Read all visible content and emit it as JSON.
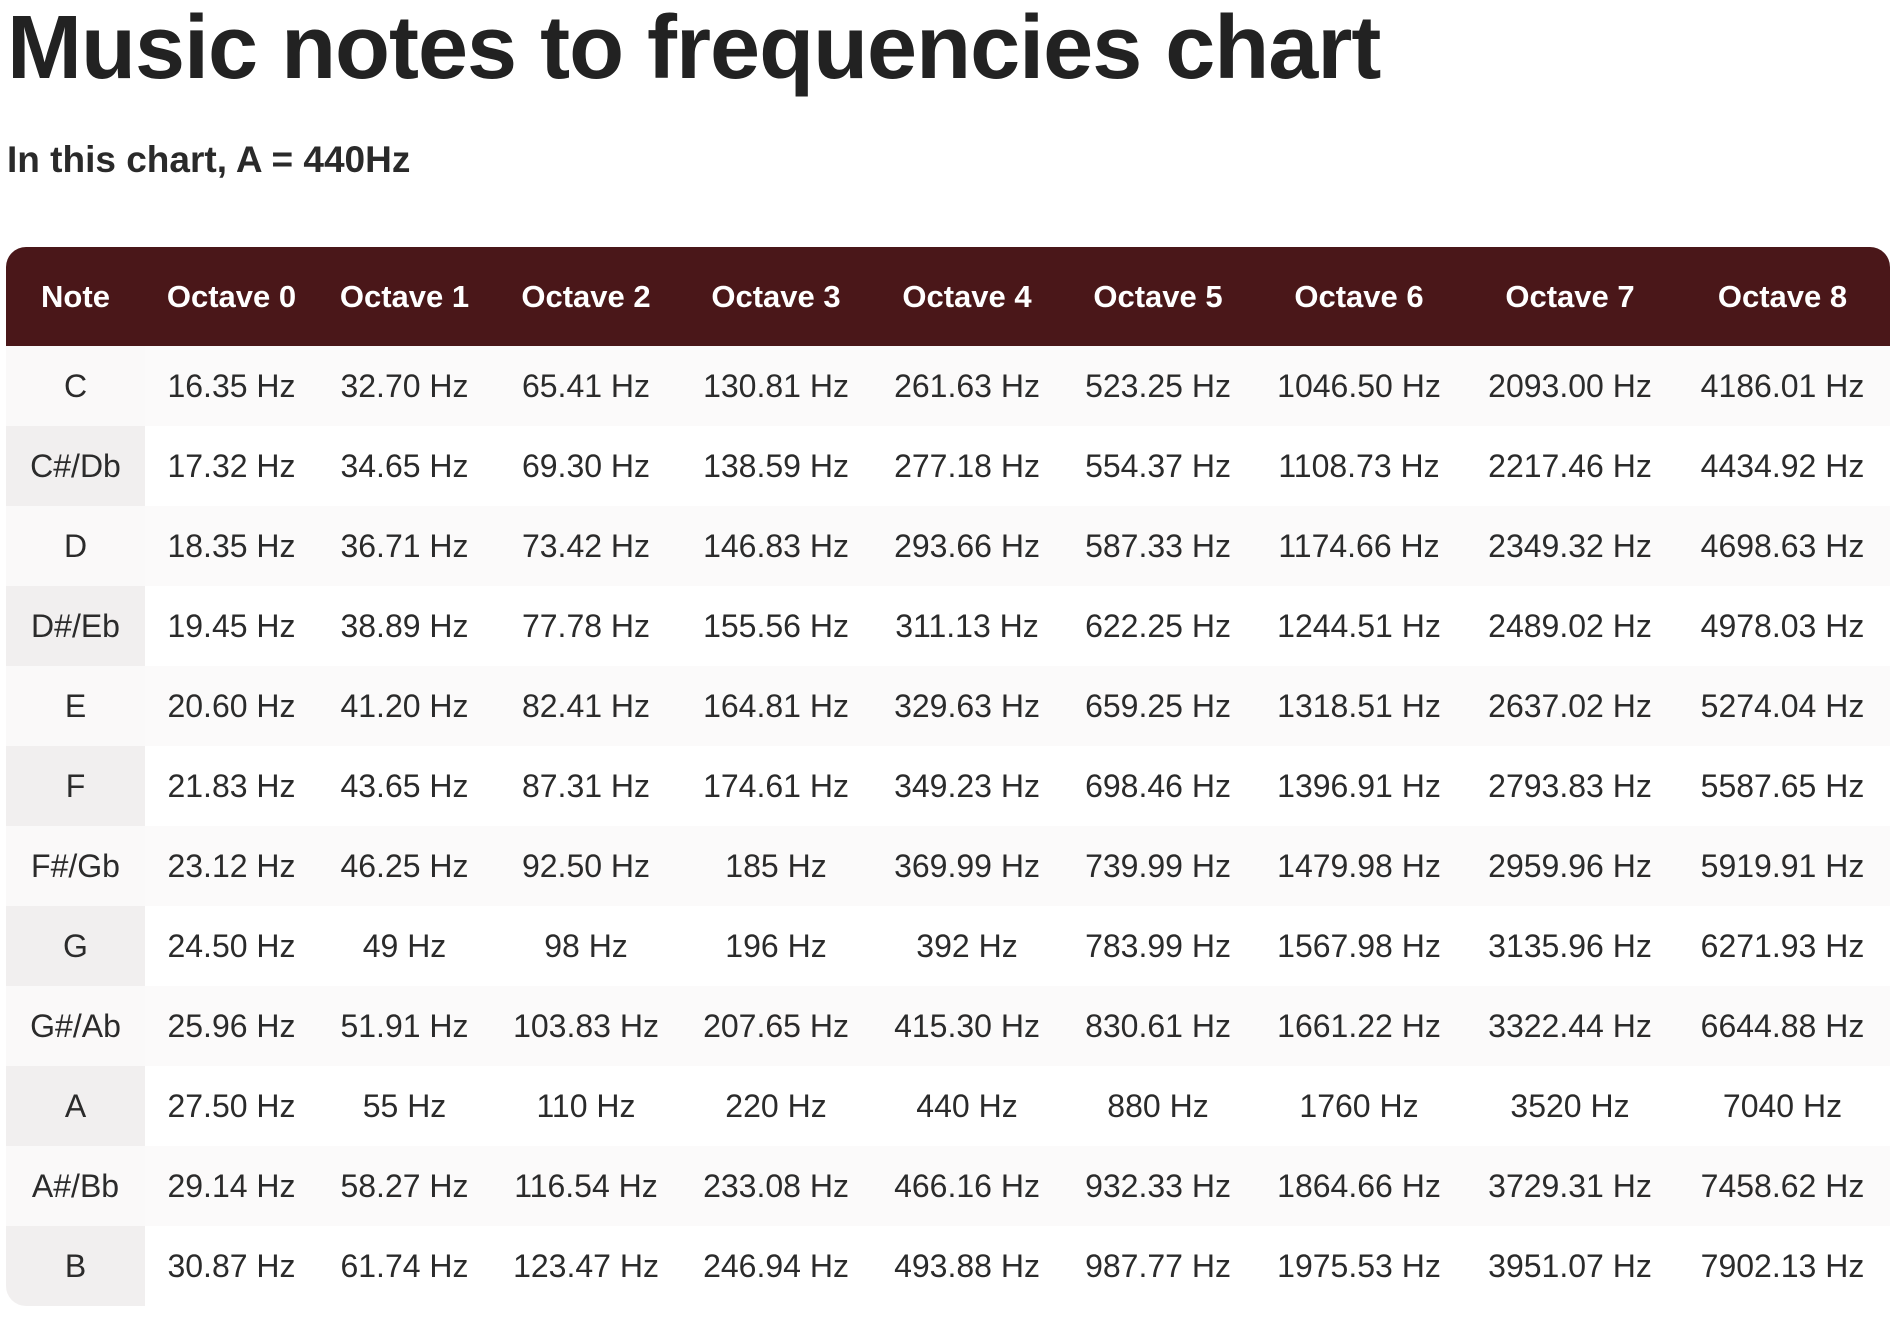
{
  "page": {
    "title": "Music notes to frequencies chart",
    "subtitle": "In this chart, A = 440Hz"
  },
  "colors": {
    "header_background": "#4a1719",
    "header_text": "#ffffff",
    "note_column_background": "#f3f1f1",
    "body_text": "#2b2b2b"
  },
  "table": {
    "headers": [
      "Note",
      "Octave 0",
      "Octave 1",
      "Octave 2",
      "Octave 3",
      "Octave 4",
      "Octave 5",
      "Octave 6",
      "Octave 7",
      "Octave 8"
    ],
    "rows": [
      {
        "note": "C",
        "values": [
          "16.35 Hz",
          "32.70 Hz",
          "65.41 Hz",
          "130.81 Hz",
          "261.63 Hz",
          "523.25 Hz",
          "1046.50 Hz",
          "2093.00 Hz",
          "4186.01 Hz"
        ]
      },
      {
        "note": "C#/Db",
        "values": [
          "17.32 Hz",
          "34.65 Hz",
          "69.30 Hz",
          "138.59 Hz",
          "277.18 Hz",
          "554.37 Hz",
          "1108.73 Hz",
          "2217.46 Hz",
          "4434.92 Hz"
        ]
      },
      {
        "note": "D",
        "values": [
          "18.35 Hz",
          "36.71 Hz",
          "73.42 Hz",
          "146.83 Hz",
          "293.66 Hz",
          "587.33 Hz",
          "1174.66 Hz",
          "2349.32 Hz",
          "4698.63 Hz"
        ]
      },
      {
        "note": "D#/Eb",
        "values": [
          "19.45 Hz",
          "38.89 Hz",
          "77.78 Hz",
          "155.56 Hz",
          "311.13 Hz",
          "622.25 Hz",
          "1244.51 Hz",
          "2489.02 Hz",
          "4978.03 Hz"
        ]
      },
      {
        "note": "E",
        "values": [
          "20.60 Hz",
          "41.20 Hz",
          "82.41 Hz",
          "164.81 Hz",
          "329.63 Hz",
          "659.25 Hz",
          "1318.51 Hz",
          "2637.02 Hz",
          "5274.04 Hz"
        ]
      },
      {
        "note": "F",
        "values": [
          "21.83 Hz",
          "43.65 Hz",
          "87.31 Hz",
          "174.61 Hz",
          "349.23 Hz",
          "698.46 Hz",
          "1396.91 Hz",
          "2793.83 Hz",
          "5587.65 Hz"
        ]
      },
      {
        "note": "F#/Gb",
        "values": [
          "23.12 Hz",
          "46.25 Hz",
          "92.50 Hz",
          "185 Hz",
          "369.99 Hz",
          "739.99 Hz",
          "1479.98 Hz",
          "2959.96 Hz",
          "5919.91 Hz"
        ]
      },
      {
        "note": "G",
        "values": [
          "24.50 Hz",
          "49 Hz",
          "98 Hz",
          "196 Hz",
          "392 Hz",
          "783.99 Hz",
          "1567.98 Hz",
          "3135.96 Hz",
          "6271.93 Hz"
        ]
      },
      {
        "note": "G#/Ab",
        "values": [
          "25.96 Hz",
          "51.91 Hz",
          "103.83 Hz",
          "207.65 Hz",
          "415.30 Hz",
          "830.61 Hz",
          "1661.22 Hz",
          "3322.44 Hz",
          "6644.88 Hz"
        ]
      },
      {
        "note": "A",
        "values": [
          "27.50 Hz",
          "55 Hz",
          "110 Hz",
          "220 Hz",
          "440 Hz",
          "880 Hz",
          "1760 Hz",
          "3520 Hz",
          "7040 Hz"
        ]
      },
      {
        "note": "A#/Bb",
        "values": [
          "29.14 Hz",
          "58.27 Hz",
          "116.54 Hz",
          "233.08 Hz",
          "466.16 Hz",
          "932.33 Hz",
          "1864.66 Hz",
          "3729.31 Hz",
          "7458.62 Hz"
        ]
      },
      {
        "note": "B",
        "values": [
          "30.87 Hz",
          "61.74 Hz",
          "123.47 Hz",
          "246.94 Hz",
          "493.88 Hz",
          "987.77 Hz",
          "1975.53 Hz",
          "3951.07 Hz",
          "7902.13 Hz"
        ]
      }
    ]
  }
}
